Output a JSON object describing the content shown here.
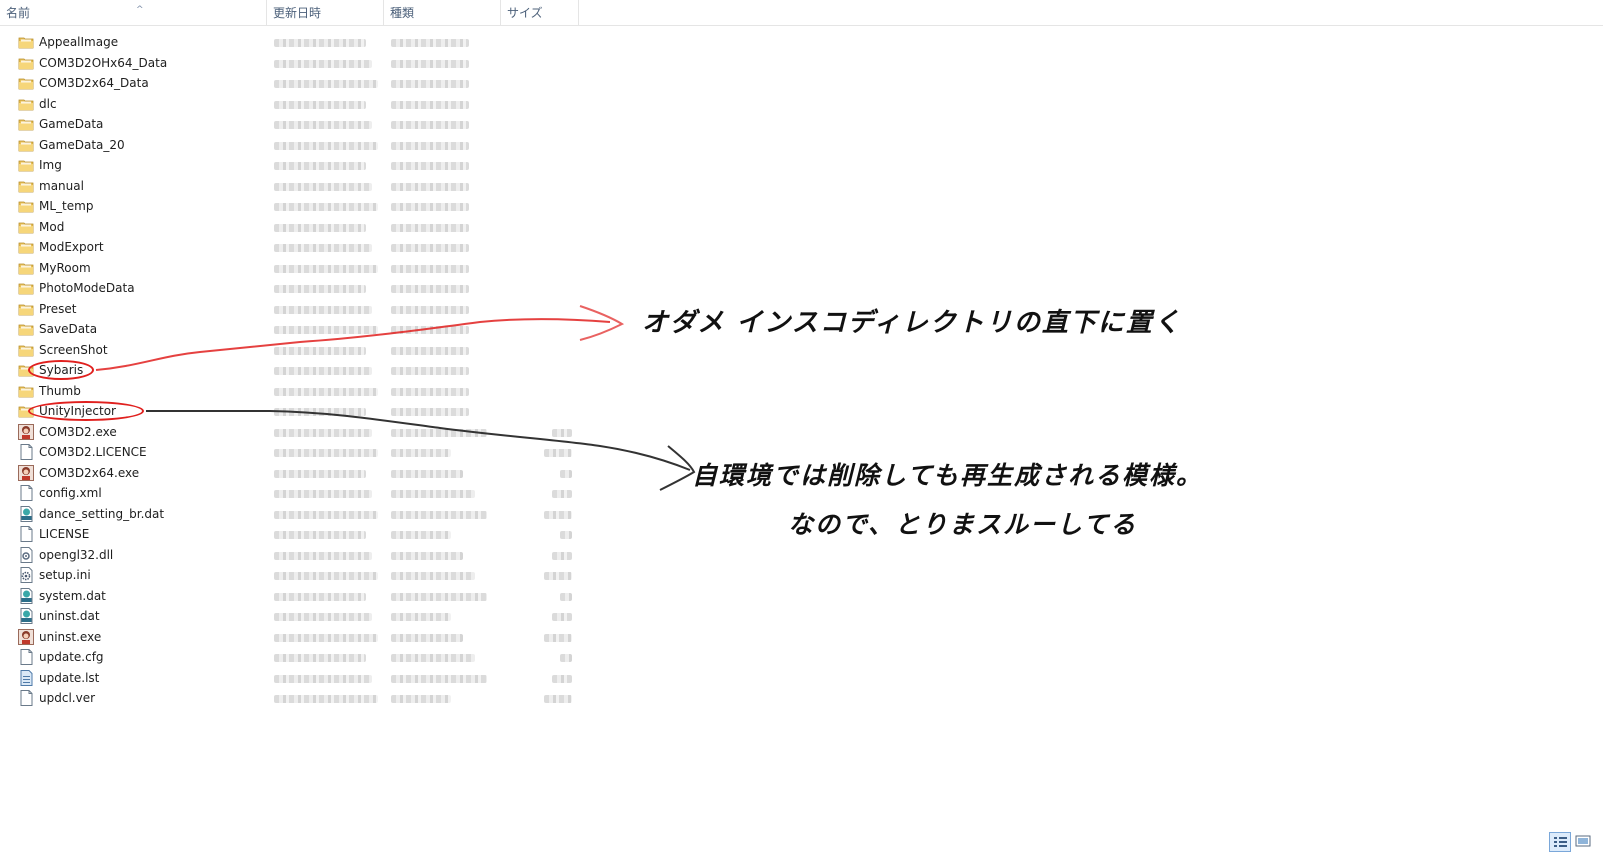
{
  "columns": {
    "name": "名前",
    "date": "更新日時",
    "type": "種類",
    "size": "サイズ"
  },
  "files": [
    {
      "name": "AppealImage",
      "icon": "folder-icon"
    },
    {
      "name": "COM3D2OHx64_Data",
      "icon": "folder-icon"
    },
    {
      "name": "COM3D2x64_Data",
      "icon": "folder-icon"
    },
    {
      "name": "dlc",
      "icon": "folder-icon"
    },
    {
      "name": "GameData",
      "icon": "folder-icon"
    },
    {
      "name": "GameData_20",
      "icon": "folder-icon"
    },
    {
      "name": "Img",
      "icon": "folder-icon"
    },
    {
      "name": "manual",
      "icon": "folder-icon"
    },
    {
      "name": "ML_temp",
      "icon": "folder-icon"
    },
    {
      "name": "Mod",
      "icon": "folder-icon"
    },
    {
      "name": "ModExport",
      "icon": "folder-icon"
    },
    {
      "name": "MyRoom",
      "icon": "folder-icon"
    },
    {
      "name": "PhotoModeData",
      "icon": "folder-icon"
    },
    {
      "name": "Preset",
      "icon": "folder-icon"
    },
    {
      "name": "SaveData",
      "icon": "folder-icon"
    },
    {
      "name": "ScreenShot",
      "icon": "folder-icon"
    },
    {
      "name": "Sybaris",
      "icon": "folder-icon"
    },
    {
      "name": "Thumb",
      "icon": "folder-icon"
    },
    {
      "name": "UnityInjector",
      "icon": "folder-icon"
    },
    {
      "name": "COM3D2.exe",
      "icon": "exe-app-icon"
    },
    {
      "name": "COM3D2.LICENCE",
      "icon": "file-icon"
    },
    {
      "name": "COM3D2x64.exe",
      "icon": "exe-app-icon"
    },
    {
      "name": "config.xml",
      "icon": "file-icon"
    },
    {
      "name": "dance_setting_br.dat",
      "icon": "dat-file-icon"
    },
    {
      "name": "LICENSE",
      "icon": "file-icon"
    },
    {
      "name": "opengl32.dll",
      "icon": "dll-file-icon"
    },
    {
      "name": "setup.ini",
      "icon": "ini-file-icon"
    },
    {
      "name": "system.dat",
      "icon": "dat-file-icon"
    },
    {
      "name": "uninst.dat",
      "icon": "dat-file-icon"
    },
    {
      "name": "uninst.exe",
      "icon": "exe-app-icon"
    },
    {
      "name": "update.cfg",
      "icon": "file-icon"
    },
    {
      "name": "update.lst",
      "icon": "list-file-icon"
    },
    {
      "name": "updcl.ver",
      "icon": "file-icon"
    }
  ],
  "annotations": {
    "red_note": "オダメ インスコディレクトリの直下に置く",
    "black_note_line1": "自環境では削除しても再生成される模様。",
    "black_note_line2": "なので、とりまスルーしてる"
  },
  "colors": {
    "red_mark": "#e0201e",
    "black_mark": "#333333",
    "folder": "#e8c15a"
  }
}
